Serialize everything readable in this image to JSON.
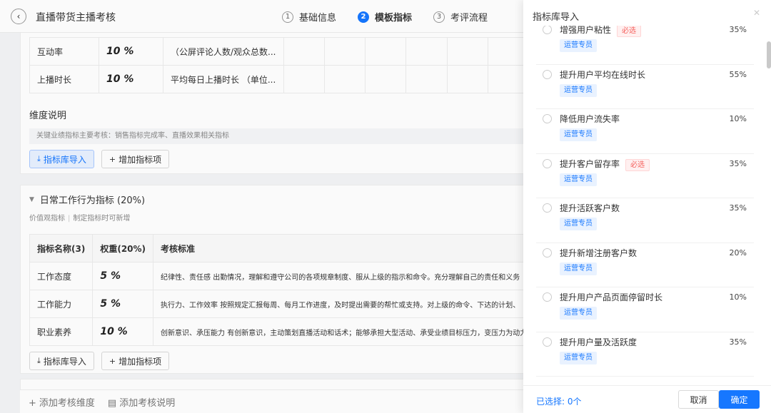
{
  "header": {
    "back_icon": "chevron-left-icon",
    "title": "直播带货主播考核",
    "steps": [
      {
        "num": "1",
        "label": "基础信息",
        "active": false
      },
      {
        "num": "2",
        "label": "模板指标",
        "active": true
      },
      {
        "num": "3",
        "label": "考评流程",
        "active": false
      }
    ]
  },
  "section1": {
    "rows": [
      {
        "name": "互动率",
        "weight": "10 %",
        "criteria": "（公屏评论人数/观众总数..."
      },
      {
        "name": "上播时长",
        "weight": "10 %",
        "criteria": "平均每日上播时长 （单位..."
      }
    ],
    "dimension_label": "维度说明",
    "dimension_note": "关键业绩指标主要考核：销售指标完成率、直播效果相关指标",
    "import_button": "指标库导入",
    "add_button": "增加指标项"
  },
  "section2": {
    "title": "日常工作行为指标 (20%)",
    "sub1": "价值观指标",
    "sub2": "制定指标时可新增",
    "columns": [
      "指标名称(3)",
      "权重(20%)",
      "考核标准"
    ],
    "rows": [
      {
        "name": "工作态度",
        "weight": "5 %",
        "criteria": "纪律性、责任感 出勤情况，理解和遵守公司的各项规章制度、服从上级的指示和命令。充分理解自己的责任和义务"
      },
      {
        "name": "工作能力",
        "weight": "5 %",
        "criteria": "执行力、工作效率 按照规定汇报每周、每月工作进度，及时提出需要的帮忙或支持。对上级的命令、下达的计划、"
      },
      {
        "name": "职业素养",
        "weight": "10 %",
        "criteria": "创新意识、承压能力 有创新意识，主动策划直播活动和话术；能够承担大型活动、承受业绩目标压力，变压力为动力"
      }
    ],
    "import_button": "指标库导入",
    "add_button": "增加指标项"
  },
  "footer": {
    "add_dimension": "添加考核维度",
    "add_note": "添加考核说明"
  },
  "drawer": {
    "title": "指标库导入",
    "items": [
      {
        "name": "增强用户粘性",
        "required": "必选",
        "role": "运营专员",
        "percent": "35%"
      },
      {
        "name": "提升用户平均在线时长",
        "required": "",
        "role": "运营专员",
        "percent": "55%"
      },
      {
        "name": "降低用户流失率",
        "required": "",
        "role": "运营专员",
        "percent": "10%"
      },
      {
        "name": "提升客户留存率",
        "required": "必选",
        "role": "运营专员",
        "percent": "35%"
      },
      {
        "name": "提升活跃客户数",
        "required": "",
        "role": "运营专员",
        "percent": "35%"
      },
      {
        "name": "提升新增注册客户数",
        "required": "",
        "role": "运营专员",
        "percent": "20%"
      },
      {
        "name": "提升用户产品页面停留时长",
        "required": "",
        "role": "运营专员",
        "percent": "10%"
      },
      {
        "name": "提升用户量及活跃度",
        "required": "",
        "role": "运营专员",
        "percent": "35%"
      }
    ],
    "selected_label": "已选择: 0个",
    "cancel": "取消",
    "ok": "确定"
  }
}
